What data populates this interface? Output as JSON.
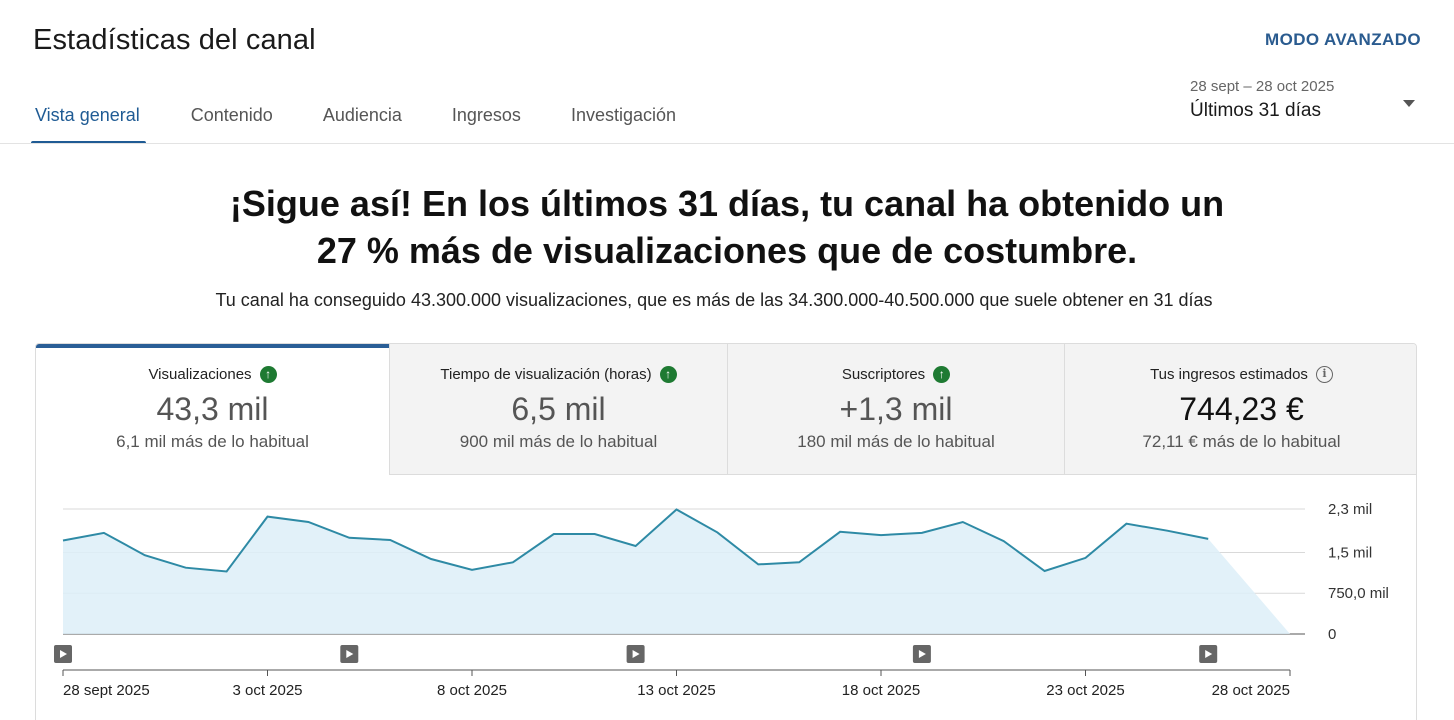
{
  "header": {
    "title": "Estadísticas del canal",
    "advanced_mode": "MODO AVANZADO"
  },
  "tabs": [
    {
      "label": "Vista general",
      "active": true
    },
    {
      "label": "Contenido",
      "active": false
    },
    {
      "label": "Audiencia",
      "active": false
    },
    {
      "label": "Ingresos",
      "active": false
    },
    {
      "label": "Investigación",
      "active": false
    }
  ],
  "date_picker": {
    "range": "28 sept – 28 oct 2025",
    "label": "Últimos 31 días"
  },
  "summary": {
    "headline_line1": "¡Sigue así! En los últimos 31 días, tu canal ha obtenido un",
    "headline_line2": "27 % más de visualizaciones que de costumbre.",
    "subline": "Tu canal ha conseguido 43.300.000 visualizaciones, que es más de las 34.300.000-40.500.000 que suele obtener en 31 días"
  },
  "metrics": [
    {
      "title": "Visualizaciones",
      "value": "43,3 mil",
      "sub": "6,1 mil más de lo habitual",
      "icon": "arrow-up-icon"
    },
    {
      "title": "Tiempo de visualización (horas)",
      "value": "6,5 mil",
      "sub": "900 mil más de lo habitual",
      "icon": "arrow-up-icon"
    },
    {
      "title": "Suscriptores",
      "value": "+1,3 mil",
      "sub": "180 mil más de lo habitual",
      "icon": "arrow-up-icon"
    },
    {
      "title": "Tus ingresos estimados",
      "value": "744,23 €",
      "sub": "72,11 € más de lo habitual",
      "icon": "info-icon"
    }
  ],
  "colors": {
    "accent": "#2a5e96",
    "line": "#2e8aa5",
    "fill": "#ddeff8",
    "up": "#1e7a32"
  },
  "chart_data": {
    "type": "area",
    "x": [
      "28 sept 2025",
      "29 sept 2025",
      "30 sept 2025",
      "1 oct 2025",
      "2 oct 2025",
      "3 oct 2025",
      "4 oct 2025",
      "5 oct 2025",
      "6 oct 2025",
      "7 oct 2025",
      "8 oct 2025",
      "9 oct 2025",
      "10 oct 2025",
      "11 oct 2025",
      "12 oct 2025",
      "13 oct 2025",
      "14 oct 2025",
      "15 oct 2025",
      "16 oct 2025",
      "17 oct 2025",
      "18 oct 2025",
      "19 oct 2025",
      "20 oct 2025",
      "21 oct 2025",
      "22 oct 2025",
      "23 oct 2025",
      "24 oct 2025",
      "25 oct 2025",
      "26 oct 2025",
      "27 oct 2025",
      "28 oct 2025"
    ],
    "values": [
      1720,
      1860,
      1450,
      1220,
      1150,
      2160,
      2060,
      1770,
      1730,
      1380,
      1180,
      1320,
      1840,
      1840,
      1620,
      2290,
      1870,
      1280,
      1320,
      1880,
      1820,
      1860,
      2060,
      1710,
      1160,
      1400,
      2030,
      1900,
      1750
    ],
    "y_unit": "visualizaciones",
    "ylim": [
      0,
      2300
    ],
    "yticks": [
      {
        "value": 2300,
        "label": "2,3 mil"
      },
      {
        "value": 1500,
        "label": "1,5 mil"
      },
      {
        "value": 750,
        "label": "750,0 mil"
      },
      {
        "value": 0,
        "label": "0"
      }
    ],
    "xtick_labels": [
      "28 sept 2025",
      "3 oct 2025",
      "8 oct 2025",
      "13 oct 2025",
      "18 oct 2025",
      "23 oct 2025",
      "28 oct 2025"
    ],
    "video_markers": [
      "28 sept 2025",
      "5 oct 2025",
      "12 oct 2025",
      "19 oct 2025",
      "26 oct 2025"
    ],
    "grid": true
  }
}
